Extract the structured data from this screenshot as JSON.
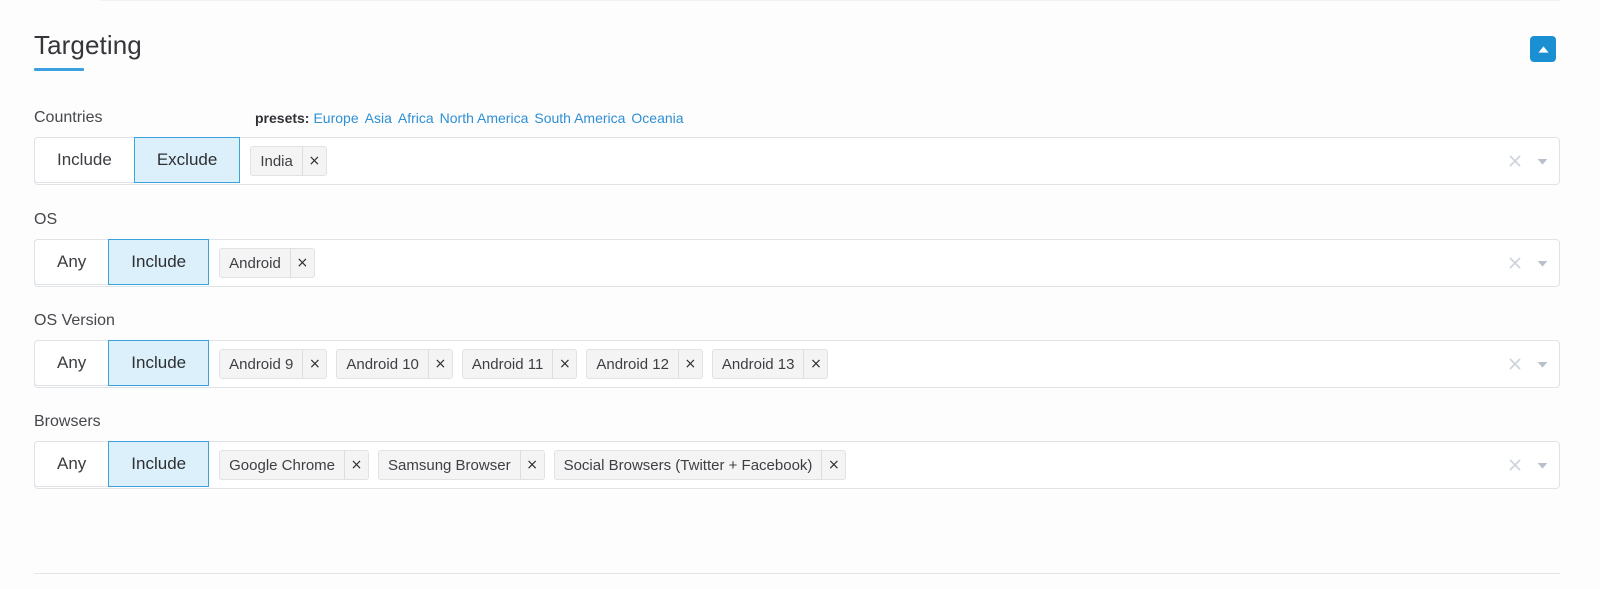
{
  "header": {
    "title": "Targeting",
    "collapse_icon": "triangle-up-icon",
    "collapse_color": "#1a8fd1",
    "underline_color": "#3aa0e0"
  },
  "presets": {
    "label": "presets:",
    "items": [
      {
        "label": "Europe"
      },
      {
        "label": "Asia"
      },
      {
        "label": "Africa"
      },
      {
        "label": "North America"
      },
      {
        "label": "South America"
      },
      {
        "label": "Oceania"
      }
    ],
    "link_color": "#2f8fd4"
  },
  "rows": [
    {
      "key": "countries",
      "label": "Countries",
      "modes": [
        {
          "label": "Include",
          "active": false
        },
        {
          "label": "Exclude",
          "active": true
        }
      ],
      "tags": [
        {
          "label": "India"
        }
      ]
    },
    {
      "key": "os",
      "label": "OS",
      "modes": [
        {
          "label": "Any",
          "active": false
        },
        {
          "label": "Include",
          "active": true
        }
      ],
      "tags": [
        {
          "label": "Android"
        }
      ]
    },
    {
      "key": "os_version",
      "label": "OS Version",
      "modes": [
        {
          "label": "Any",
          "active": false
        },
        {
          "label": "Include",
          "active": true
        }
      ],
      "tags": [
        {
          "label": "Android 9"
        },
        {
          "label": "Android 10"
        },
        {
          "label": "Android 11"
        },
        {
          "label": "Android 12"
        },
        {
          "label": "Android 13"
        }
      ]
    },
    {
      "key": "browsers",
      "label": "Browsers",
      "modes": [
        {
          "label": "Any",
          "active": false
        },
        {
          "label": "Include",
          "active": true
        }
      ],
      "tags": [
        {
          "label": "Google Chrome"
        },
        {
          "label": "Samsung Browser"
        },
        {
          "label": "Social Browsers (Twitter + Facebook)"
        }
      ]
    }
  ],
  "icons": {
    "tag_remove": "×",
    "clear": "clear-icon",
    "caret": "chevron-down-icon"
  },
  "active_mode_color": "#3aa3dd",
  "active_mode_background": "#dcf0fb"
}
